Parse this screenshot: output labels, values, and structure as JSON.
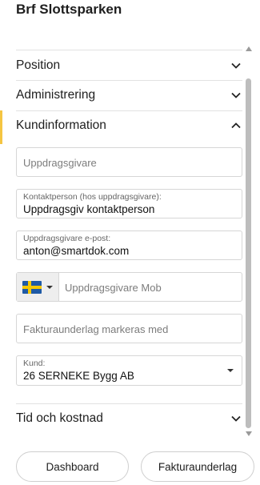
{
  "title": "Brf Slottsparken",
  "sections": {
    "position": "Position",
    "administrering": "Administrering",
    "kundinformation": "Kundinformation",
    "tid_och_kostnad": "Tid och kostnad"
  },
  "fields": {
    "uppdragsgivare_placeholder": "Uppdragsgivare",
    "kontaktperson_label": "Kontaktperson (hos uppdragsgivare):",
    "kontaktperson_value": "Uppdragsgiv kontaktperson",
    "epost_label": "Uppdragsgivare e-post:",
    "epost_value": "anton@smartdok.com",
    "mob_placeholder": "Uppdragsgivare Mob",
    "fakturaunderlag_placeholder": "Fakturaunderlag markeras med",
    "kund_label": "Kund:",
    "kund_value": "26 SERNEKE Bygg AB"
  },
  "buttons": {
    "dashboard": "Dashboard",
    "fakturaunderlag": "Fakturaunderlag"
  },
  "colors": {
    "accent": "#f5c542",
    "flag_blue": "#1f5aa6",
    "flag_yellow": "#f6c800"
  },
  "icons": {
    "chevron_collapsed": "chevron-down-icon",
    "chevron_expanded": "chevron-up-icon",
    "country_flag": "sweden-flag-icon"
  }
}
